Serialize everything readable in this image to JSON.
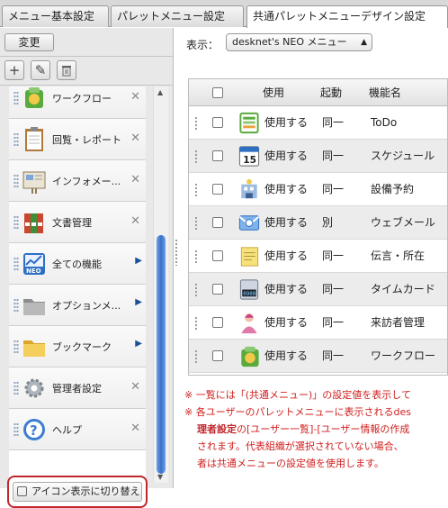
{
  "tabs": [
    {
      "label": "メニュー基本設定",
      "active": false
    },
    {
      "label": "パレットメニュー設定",
      "active": false
    },
    {
      "label": "共通パレットメニューデザイン設定",
      "active": true
    }
  ],
  "left": {
    "change_label": "変更",
    "tool_icons": [
      "plus-icon",
      "pencil-icon",
      "trash-icon"
    ],
    "items": [
      {
        "label": "ワークフロー",
        "icon": "workflow-icon",
        "action": "close"
      },
      {
        "label": "回覧・レポート",
        "icon": "clipboard-icon",
        "action": "close"
      },
      {
        "label": "インフォメー...",
        "icon": "information-board-icon",
        "action": "close"
      },
      {
        "label": "文書管理",
        "icon": "binders-icon",
        "action": "close"
      },
      {
        "label": "全ての機能",
        "icon": "neo-chart-icon",
        "action": "arrow"
      },
      {
        "label": "オプションメ...",
        "icon": "grey-folder-icon",
        "action": "arrow"
      },
      {
        "label": "ブックマーク",
        "icon": "yellow-folder-icon",
        "action": "arrow"
      },
      {
        "label": "管理者設定",
        "icon": "gear-icon",
        "action": "close"
      },
      {
        "label": "ヘルプ",
        "icon": "help-icon",
        "action": "close"
      }
    ],
    "toggle_label": "アイコン表示に切り替え"
  },
  "main": {
    "display_label": "表示：",
    "select_value": "desknet's NEO メニュー",
    "columns": [
      "使用",
      "起動",
      "機能名"
    ],
    "rows": [
      {
        "use": "使用する",
        "launch": "同一",
        "name": "ToDo",
        "icon": "todo-icon"
      },
      {
        "use": "使用する",
        "launch": "同一",
        "name": "スケジュール",
        "icon": "calendar-icon",
        "badge": "15"
      },
      {
        "use": "使用する",
        "launch": "同一",
        "name": "設備予約",
        "icon": "facility-icon"
      },
      {
        "use": "使用する",
        "launch": "別",
        "name": "ウェブメール",
        "icon": "webmail-icon"
      },
      {
        "use": "使用する",
        "launch": "同一",
        "name": "伝言・所在",
        "icon": "memo-icon"
      },
      {
        "use": "使用する",
        "launch": "同一",
        "name": "タイムカード",
        "icon": "timecard-icon",
        "badge": "0900"
      },
      {
        "use": "使用する",
        "launch": "同一",
        "name": "来訪者管理",
        "icon": "visitor-icon"
      },
      {
        "use": "使用する",
        "launch": "同一",
        "name": "ワークフロー",
        "icon": "workflow-icon"
      }
    ],
    "notes": {
      "line1": "※ 一覧には「(共通メニュー)」の設定値を表示して",
      "line2": "※ 各ユーザーのパレットメニューに表示されるdes",
      "line3_bold": "理者設定",
      "line3_rest": "の[ユーザー一覧]-[ユーザー情報の作成",
      "line4": "されます。代表組織が選択されていない場合、",
      "line5": "者は共通メニューの設定値を使用します。"
    }
  },
  "colors": {
    "accent_red": "#c0262c",
    "scroll_blue": "#3a70c9"
  }
}
